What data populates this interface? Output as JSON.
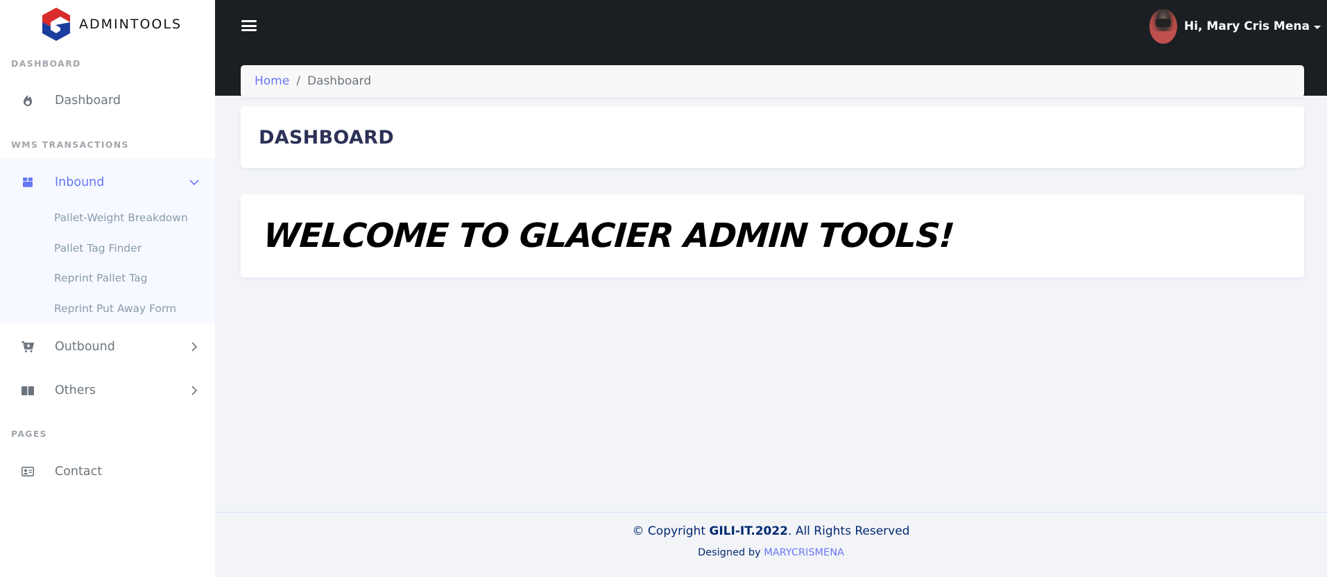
{
  "brand": {
    "name": "ADMINTOOLS",
    "logo_icon": "hexagon-g-logo",
    "logo_colors": {
      "red": "#d92b2b",
      "blue": "#1a3d9e"
    }
  },
  "sidebar": {
    "sections": [
      {
        "label": "DASHBOARD"
      },
      {
        "label": "WMS TRANSACTIONS"
      },
      {
        "label": "PAGES"
      }
    ],
    "items": [
      {
        "label": "Dashboard",
        "icon": "flame-icon"
      },
      {
        "label": "Inbound",
        "icon": "box-icon",
        "expanded": true,
        "active": true,
        "children": [
          {
            "label": "Pallet-Weight Breakdown"
          },
          {
            "label": "Pallet Tag Finder"
          },
          {
            "label": "Reprint Pallet Tag"
          },
          {
            "label": "Reprint Put Away Form"
          }
        ]
      },
      {
        "label": "Outbound",
        "icon": "cart-icon",
        "expanded": false
      },
      {
        "label": "Others",
        "icon": "book-icon",
        "expanded": false
      },
      {
        "label": "Contact",
        "icon": "id-card-icon"
      }
    ]
  },
  "topbar": {
    "menu_icon": "hamburger-icon",
    "user_greeting": "Hi, Mary Cris Mena"
  },
  "breadcrumb": {
    "home": "Home",
    "separator": "/",
    "current": "Dashboard"
  },
  "page": {
    "title": "DASHBOARD",
    "welcome": "WELCOME TO GLACIER ADMIN TOOLS!"
  },
  "footer": {
    "copyright_prefix": "© Copyright ",
    "copyright_owner": "GILI-IT.2022",
    "copyright_suffix": ". All Rights Reserved",
    "designed_by_prefix": "Designed by ",
    "designer": "MARYCRISMENA"
  },
  "colors": {
    "accent": "#6776f4",
    "topbar_bg": "#1b1e23",
    "page_bg": "#f3f4f8",
    "title": "#2c3257",
    "footer_text": "#012970"
  }
}
